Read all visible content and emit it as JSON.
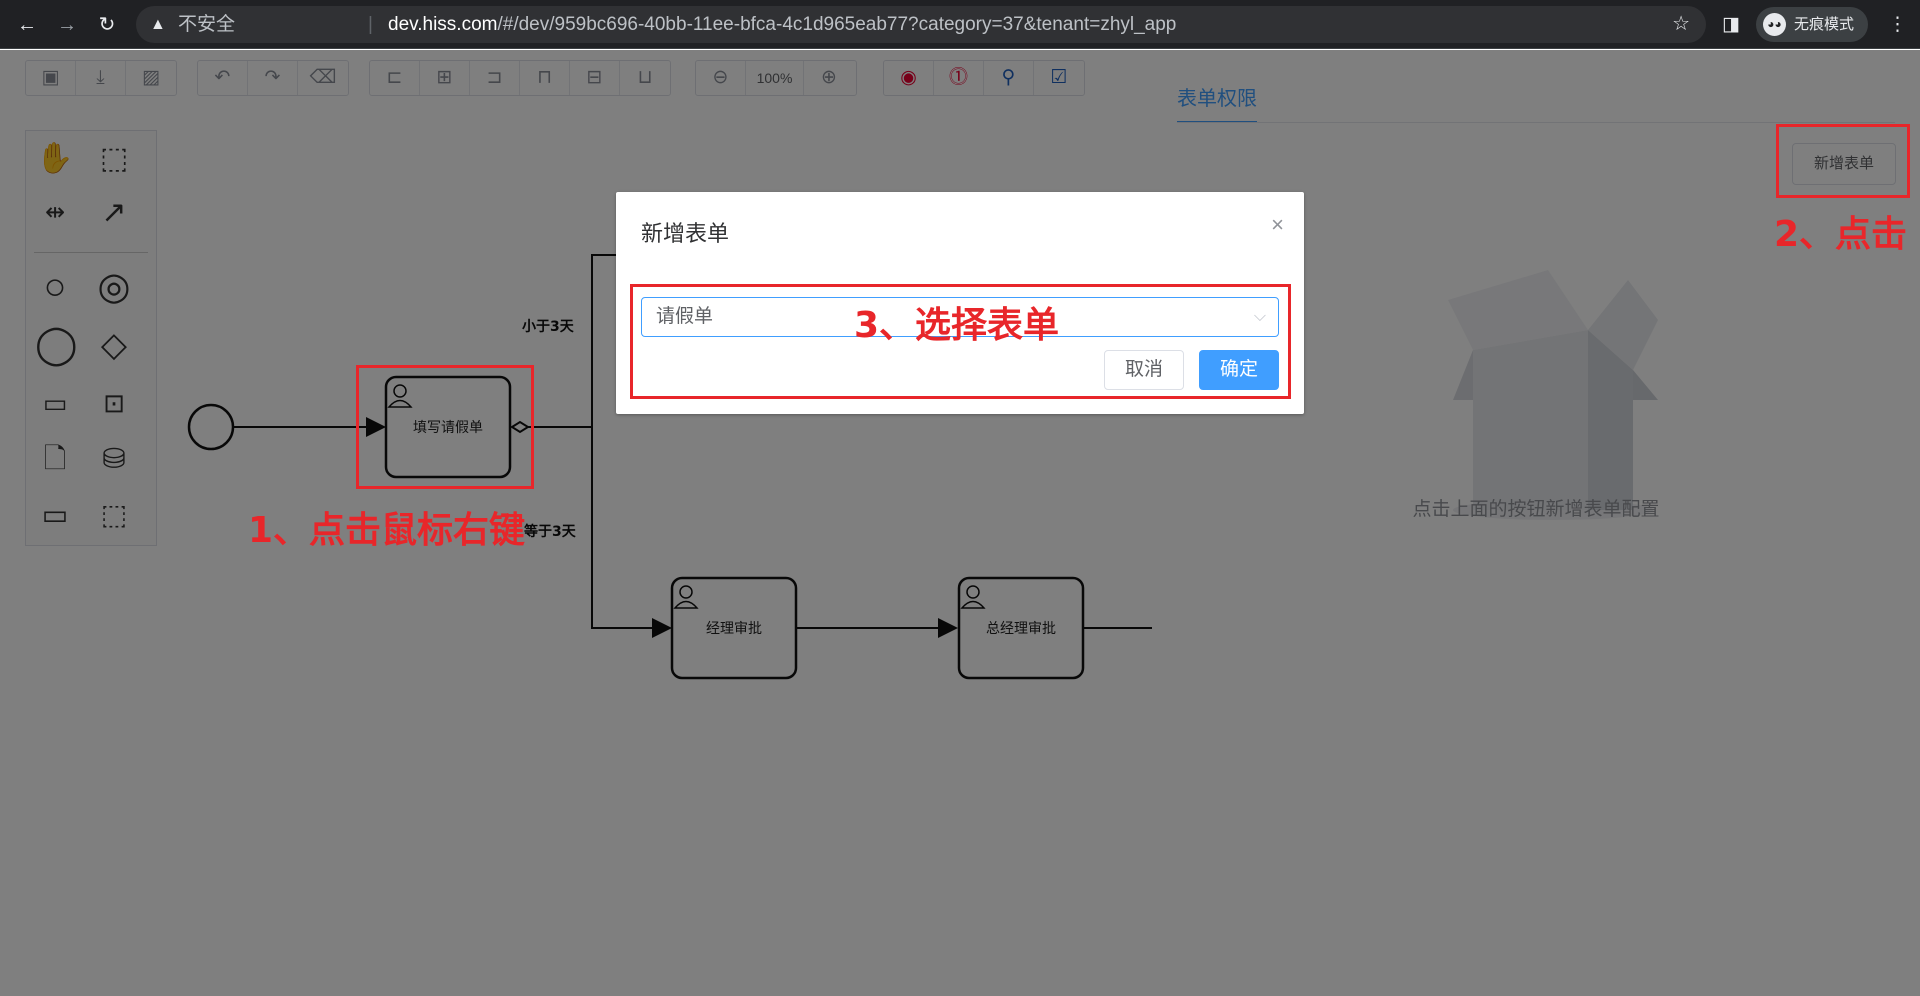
{
  "browser": {
    "security_label": "不安全",
    "url_host": "dev.hiss.com",
    "url_rest": "/#/dev/959bc696-40bb-11ee-bfca-4c1d965eab77?category=37&tenant=zhyl_app",
    "incognito_label": "无痕模式"
  },
  "toolbar": {
    "zoom_label": "100%"
  },
  "diagram": {
    "tasks": {
      "fill_leave_form": "填写请假单",
      "manager_approval": "经理审批",
      "gm_approval": "总经理审批"
    },
    "flow_labels": {
      "less_than": "小于3天",
      "greater_equal": "等于3天"
    }
  },
  "panel": {
    "tab_label": "表单权限",
    "add_form_button": "新增表单",
    "empty_text": "点击上面的按钮新增表单配置"
  },
  "dialog": {
    "title": "新增表单",
    "close_glyph": "×",
    "selected_value": "请假单",
    "cancel_label": "取消",
    "confirm_label": "确定"
  },
  "annotations": {
    "step1": "1、点击鼠标右键",
    "step2": "2、点击",
    "step3": "3、选择表单"
  },
  "colors": {
    "accent": "#409eff",
    "annotation": "#e8262a",
    "chrome_bg": "#202124"
  }
}
